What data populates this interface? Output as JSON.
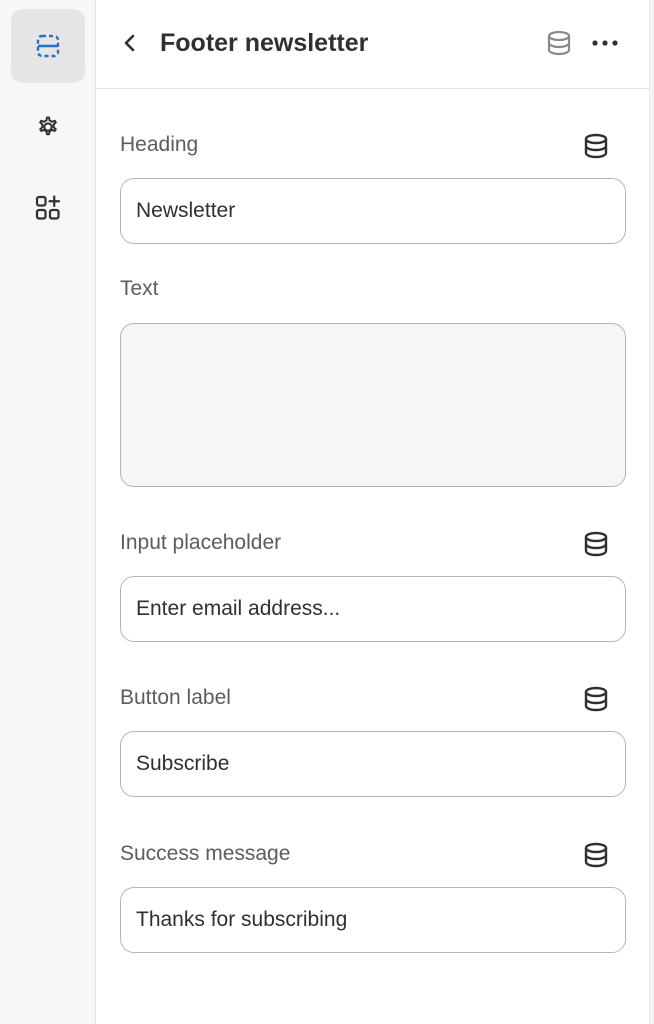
{
  "header": {
    "title": "Footer newsletter"
  },
  "rail": {
    "items": [
      {
        "icon": "sections-icon",
        "active": true
      },
      {
        "icon": "gear-icon",
        "active": false
      },
      {
        "icon": "apps-icon",
        "active": false
      }
    ]
  },
  "fields": {
    "heading": {
      "label": "Heading",
      "value": "Newsletter"
    },
    "text": {
      "label": "Text",
      "value": ""
    },
    "input_placeholder": {
      "label": "Input placeholder",
      "value": "Enter email address..."
    },
    "button_label": {
      "label": "Button label",
      "value": "Subscribe"
    },
    "success_message": {
      "label": "Success message",
      "value": "Thanks for subscribing"
    }
  },
  "colors": {
    "accent": "#2c6ecb",
    "text": "#303030",
    "label": "#5c5c5c",
    "border": "#b5b5b5"
  }
}
